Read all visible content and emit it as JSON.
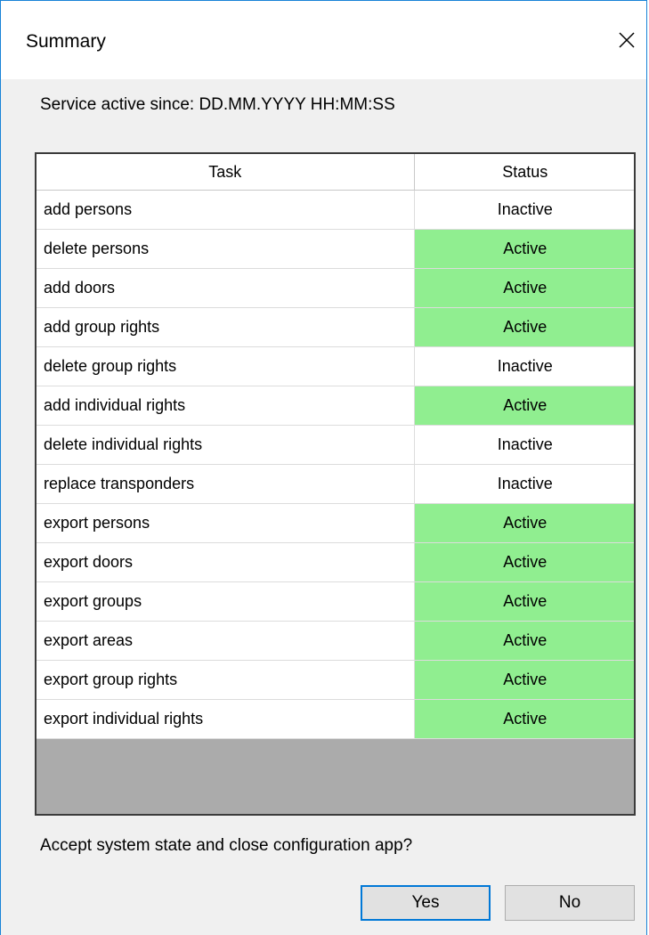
{
  "window": {
    "title": "Summary",
    "close_icon": "close-icon"
  },
  "service_since": "Service active since: DD.MM.YYYY HH:MM:SS",
  "table": {
    "columns": [
      "Task",
      "Status"
    ],
    "rows": [
      {
        "task": "add persons",
        "status": "Inactive"
      },
      {
        "task": "delete persons",
        "status": "Active"
      },
      {
        "task": "add doors",
        "status": "Active"
      },
      {
        "task": "add group rights",
        "status": "Active"
      },
      {
        "task": "delete group rights",
        "status": "Inactive"
      },
      {
        "task": "add individual rights",
        "status": "Active"
      },
      {
        "task": "delete individual rights",
        "status": "Inactive"
      },
      {
        "task": "replace transponders",
        "status": "Inactive"
      },
      {
        "task": "export persons",
        "status": "Active"
      },
      {
        "task": "export doors",
        "status": "Active"
      },
      {
        "task": "export groups",
        "status": "Active"
      },
      {
        "task": "export areas",
        "status": "Active"
      },
      {
        "task": "export group rights",
        "status": "Active"
      },
      {
        "task": "export individual rights",
        "status": "Active"
      }
    ]
  },
  "colors": {
    "active_status": "#90ee90",
    "empty_area": "#ababab",
    "accent_border": "#0078d7"
  },
  "question": "Accept system state and close configuration app?",
  "buttons": {
    "yes": "Yes",
    "no": "No"
  }
}
